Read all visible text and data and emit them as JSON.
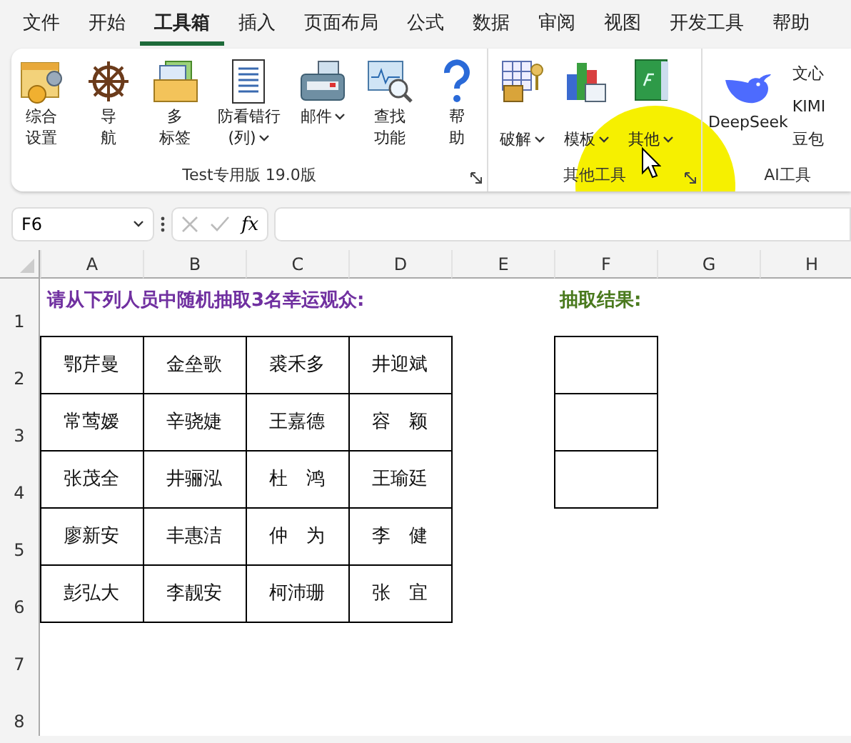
{
  "menu_tabs": [
    {
      "label": "文件",
      "selected": false
    },
    {
      "label": "开始",
      "selected": false
    },
    {
      "label": "工具箱",
      "selected": true
    },
    {
      "label": "插入",
      "selected": false
    },
    {
      "label": "页面布局",
      "selected": false
    },
    {
      "label": "公式",
      "selected": false
    },
    {
      "label": "数据",
      "selected": false
    },
    {
      "label": "审阅",
      "selected": false
    },
    {
      "label": "视图",
      "selected": false
    },
    {
      "label": "开发工具",
      "selected": false
    },
    {
      "label": "帮助",
      "selected": false
    }
  ],
  "ribbon_groups": [
    {
      "title": "Test专用版 19.0版",
      "kind": "large",
      "buttons": [
        {
          "lines": [
            "综合",
            "设置"
          ],
          "dropdown": false
        },
        {
          "lines": [
            "导",
            "航"
          ],
          "dropdown": false
        },
        {
          "lines": [
            "多",
            "标签"
          ],
          "dropdown": false
        },
        {
          "lines": [
            "防看错行",
            "(列)"
          ],
          "dropdown": true
        },
        {
          "lines": [
            "邮件"
          ],
          "dropdown": true
        },
        {
          "lines": [
            "查找",
            "功能"
          ],
          "dropdown": false
        },
        {
          "lines": [
            "帮",
            "助"
          ],
          "dropdown": false
        }
      ]
    },
    {
      "title": "其他工具",
      "kind": "large",
      "buttons": [
        {
          "lines": [
            "破解"
          ],
          "dropdown": true
        },
        {
          "lines": [
            "模板"
          ],
          "dropdown": true
        },
        {
          "lines": [
            "其他"
          ],
          "dropdown": true
        }
      ]
    },
    {
      "title": "AI工具",
      "kind": "ai",
      "buttons": [
        {
          "lines": [
            "DeepSeek"
          ],
          "dropdown": false
        }
      ],
      "small_items": [
        "文心",
        "KIMI",
        "豆包"
      ]
    }
  ],
  "formula_bar": {
    "name_box": "F6",
    "fx": "fx"
  },
  "columns": [
    "A",
    "B",
    "C",
    "D",
    "E",
    "F",
    "G",
    "H"
  ],
  "row_numbers": [
    "1",
    "2",
    "3",
    "4",
    "5",
    "6",
    "7",
    "8"
  ],
  "title": "请从下列人员中随机抽取3名幸运观众:",
  "names": [
    [
      "鄂芹曼",
      "金垒歌",
      "裘禾多",
      "井迎斌"
    ],
    [
      "常莺嫒",
      "辛骁婕",
      "王嘉德",
      "容　颖"
    ],
    [
      "张茂全",
      "井骊泓",
      "杜　鸿",
      "王瑜廷"
    ],
    [
      "廖新安",
      "丰惠洁",
      "仲　为",
      "李　健"
    ],
    [
      "彭弘大",
      "李靓安",
      "柯沛珊",
      "张　宜"
    ]
  ],
  "result_title": "抽取结果:"
}
